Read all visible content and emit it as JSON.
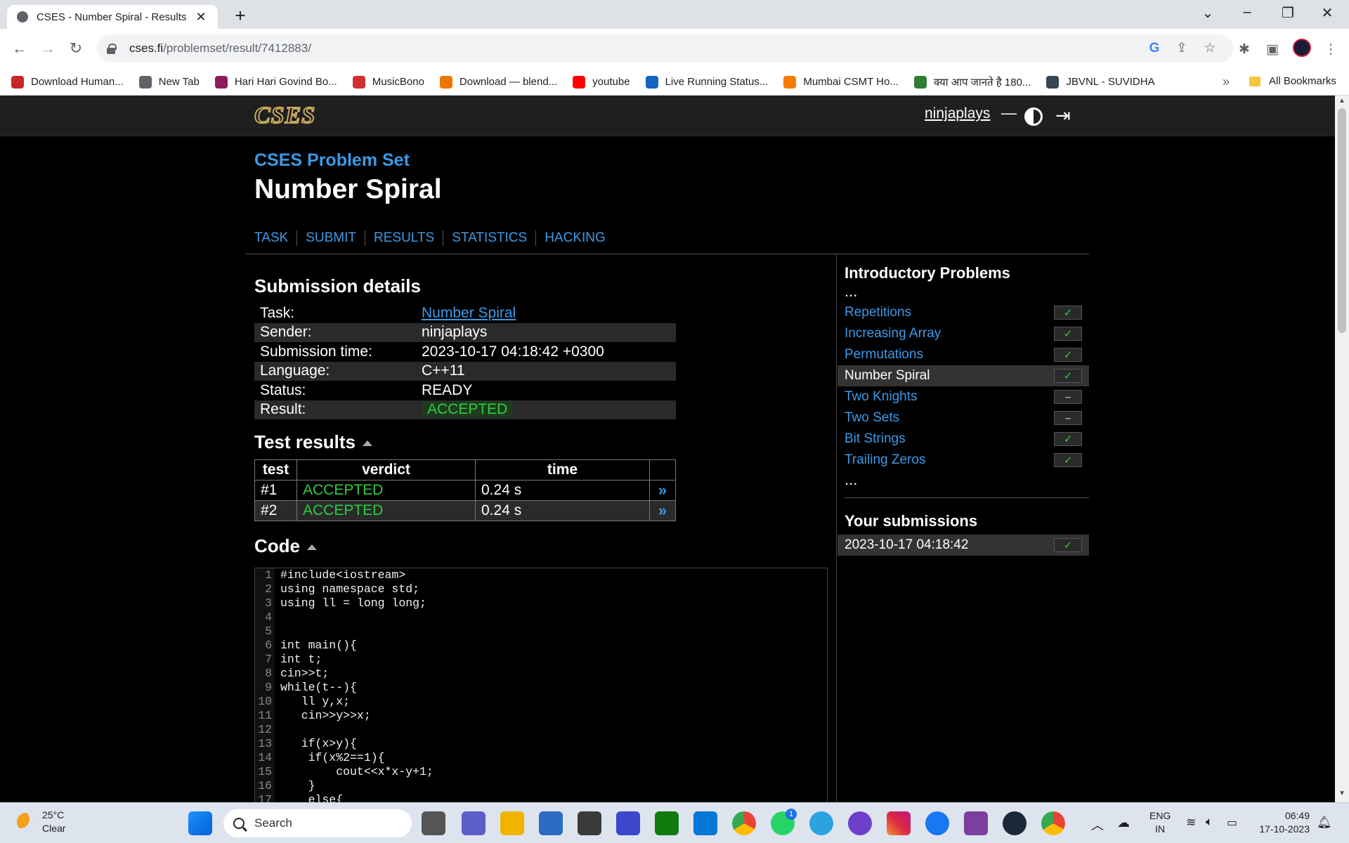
{
  "browser": {
    "tab_title": "CSES - Number Spiral - Results",
    "url_host": "cses.fi",
    "url_path": "/problemset/result/7412883/",
    "bookmarks": [
      {
        "label": "Download Human...",
        "color": "#c62828"
      },
      {
        "label": "New Tab",
        "color": "#5f6368"
      },
      {
        "label": "Hari Hari Govind Bo...",
        "color": "#8e1b5c"
      },
      {
        "label": "MusicBono",
        "color": "#d32f2f"
      },
      {
        "label": "Download — blend...",
        "color": "#ea7600"
      },
      {
        "label": "youtube",
        "color": "#ff0000"
      },
      {
        "label": "Live Running Status...",
        "color": "#1565c0"
      },
      {
        "label": "Mumbai CSMT Ho...",
        "color": "#f57c00"
      },
      {
        "label": "क्या आप जानते है 180...",
        "color": "#2e7d32"
      },
      {
        "label": "JBVNL - SUVIDHA",
        "color": "#37474f"
      }
    ],
    "bookmarks_more": "»",
    "all_bookmarks": "All Bookmarks"
  },
  "site": {
    "logo": "CSES",
    "username": "ninjaplays",
    "dash": "—",
    "problemset_title": "CSES Problem Set",
    "problem_title": "Number Spiral",
    "tabs": [
      "TASK",
      "SUBMIT",
      "RESULTS",
      "STATISTICS",
      "HACKING"
    ]
  },
  "submission": {
    "heading": "Submission details",
    "rows": [
      {
        "label": "Task:",
        "value": "Number Spiral"
      },
      {
        "label": "Sender:",
        "value": "ninjaplays"
      },
      {
        "label": "Submission time:",
        "value": "2023-10-17 04:18:42 +0300"
      },
      {
        "label": "Language:",
        "value": "C++11"
      },
      {
        "label": "Status:",
        "value": "READY"
      },
      {
        "label": "Result:",
        "value": "ACCEPTED"
      }
    ]
  },
  "tests": {
    "heading": "Test results",
    "columns": [
      "test",
      "verdict",
      "time",
      ""
    ],
    "rows": [
      {
        "test": "#1",
        "verdict": "ACCEPTED",
        "time": "0.24 s"
      },
      {
        "test": "#2",
        "verdict": "ACCEPTED",
        "time": "0.24 s"
      }
    ]
  },
  "code": {
    "heading": "Code",
    "lines": [
      "#include<iostream>",
      "using namespace std;",
      "using ll = long long;",
      "",
      "",
      "int main(){",
      "int t;",
      "cin>>t;",
      "while(t--){",
      "   ll y,x;",
      "   cin>>y>>x;",
      "",
      "   if(x>y){",
      "    if(x%2==1){",
      "        cout<<x*x-y+1;",
      "    }",
      "    else{"
    ]
  },
  "sidebar": {
    "title": "Introductory Problems",
    "dots": "...",
    "items": [
      {
        "name": "Repetitions",
        "solved": true
      },
      {
        "name": "Increasing Array",
        "solved": true
      },
      {
        "name": "Permutations",
        "solved": true
      },
      {
        "name": "Number Spiral",
        "solved": true,
        "current": true
      },
      {
        "name": "Two Knights",
        "solved": false
      },
      {
        "name": "Two Sets",
        "solved": false
      },
      {
        "name": "Bit Strings",
        "solved": true
      },
      {
        "name": "Trailing Zeros",
        "solved": true
      }
    ],
    "submissions_title": "Your submissions",
    "submissions": [
      {
        "time": "2023-10-17 04:18:42",
        "solved": true
      }
    ]
  },
  "taskbar": {
    "temperature": "25°C",
    "condition": "Clear",
    "search_placeholder": "Search",
    "whatsapp_badge": "1",
    "lang_primary": "ENG",
    "lang_secondary": "IN",
    "time": "06:49",
    "date": "17-10-2023"
  },
  "colors": {
    "link": "#3b9ae8",
    "accepted": "#2ecc40",
    "logo_gold": "#c9a862"
  }
}
